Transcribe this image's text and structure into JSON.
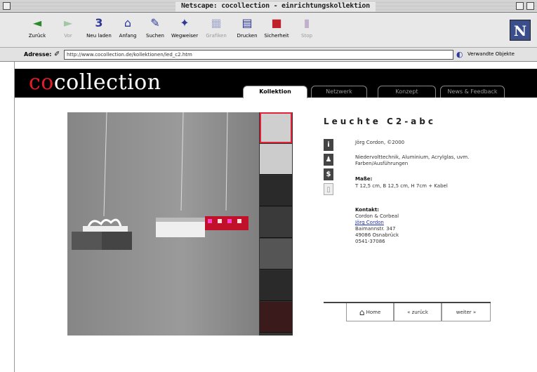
{
  "window": {
    "title": "Netscape: cocollection - einrichtungskollektion"
  },
  "toolbar": {
    "buttons": [
      {
        "label": "Zurück",
        "icon": "back-arrow-icon"
      },
      {
        "label": "Vor",
        "icon": "forward-arrow-icon"
      },
      {
        "label": "Neu laden",
        "icon": "reload-icon"
      },
      {
        "label": "Anfang",
        "icon": "home-icon"
      },
      {
        "label": "Suchen",
        "icon": "search-icon"
      },
      {
        "label": "Wegweiser",
        "icon": "guide-icon"
      },
      {
        "label": "Grafiken",
        "icon": "images-icon"
      },
      {
        "label": "Drucken",
        "icon": "print-icon"
      },
      {
        "label": "Sicherheit",
        "icon": "security-lock-icon"
      },
      {
        "label": "Stop",
        "icon": "stop-icon"
      }
    ]
  },
  "address": {
    "label": "Adresse:",
    "url": "http://www.cocollection.de/kollektionen/led_c2.htm",
    "related": "Verwandte Objekte"
  },
  "site": {
    "brand_co": "co",
    "brand_rest": "collection",
    "nav": [
      "Kollektion",
      "Netzwerk",
      "Konzept",
      "News & Feedback"
    ]
  },
  "product": {
    "title": "Leuchte C2-abc",
    "designer": "Jörg Cordon, ©2000",
    "materials": "Niedervolttechnik, Aluminium, Acrylglas, uvm. Farben/Ausführungen",
    "dims_label": "Maße:",
    "dims_value": "T 12,5 cm, B 12,5 cm, H 7cm + Kabel",
    "contact_label": "Kontakt:",
    "contact_company": "Cordon & Corbeal",
    "contact_link": "Jörg Cordon",
    "contact_street": "Baimannstr. 347",
    "contact_city": "49086 Osnabrück",
    "contact_phone": "0541-37086"
  },
  "footer": {
    "home": "Home",
    "back": "« zurück",
    "next": "weiter »"
  }
}
